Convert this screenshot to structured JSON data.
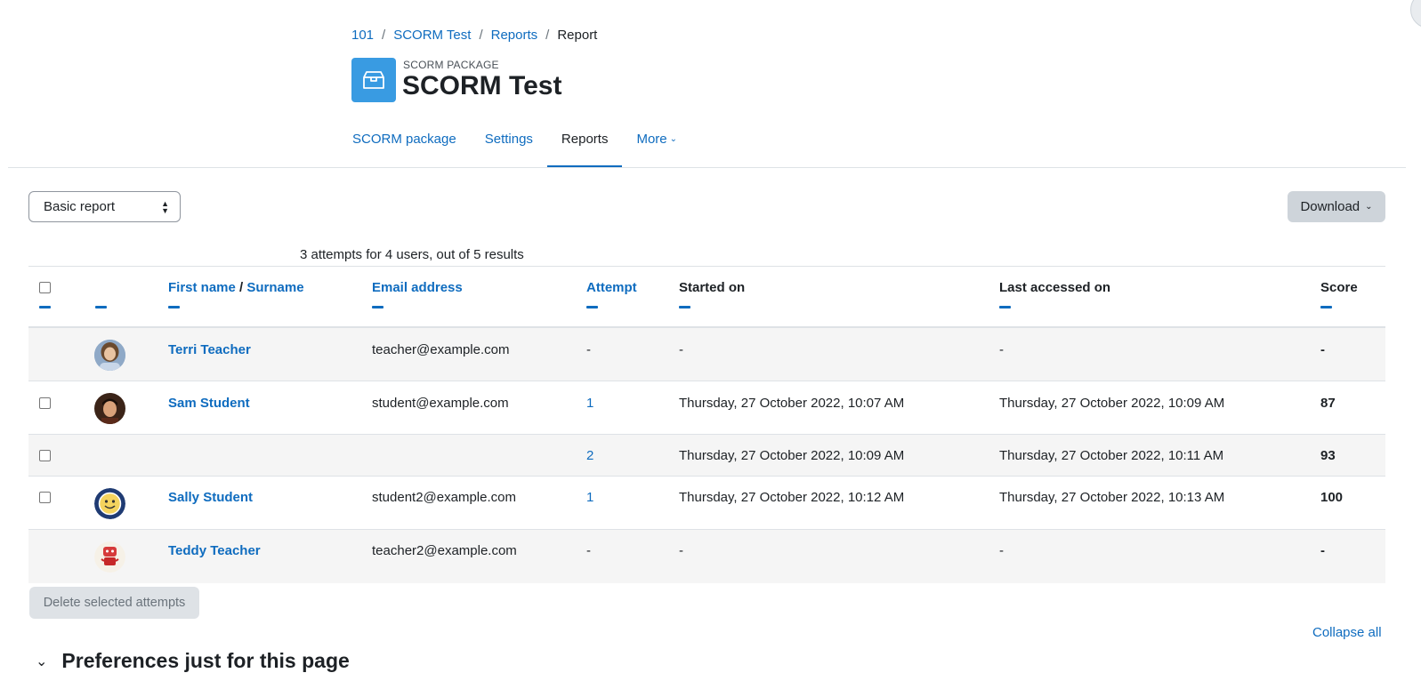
{
  "breadcrumb": [
    "101",
    "SCORM Test",
    "Reports",
    "Report"
  ],
  "header": {
    "module_label": "SCORM PACKAGE",
    "title": "SCORM Test",
    "icon": "package-icon",
    "icon_color": "#399be2"
  },
  "tabs": [
    {
      "label": "SCORM package",
      "active": false
    },
    {
      "label": "Settings",
      "active": false
    },
    {
      "label": "Reports",
      "active": true
    },
    {
      "label": "More",
      "active": false
    }
  ],
  "report_select": {
    "value": "Basic report"
  },
  "download": {
    "label": "Download"
  },
  "summary": "3 attempts for 4 users, out of 5 results",
  "table": {
    "headers": {
      "firstname": "First name",
      "name_separator": "/",
      "surname": "Surname",
      "email": "Email address",
      "attempt": "Attempt",
      "started": "Started on",
      "last_accessed": "Last accessed on",
      "score": "Score"
    },
    "rows": [
      {
        "name": "Terri Teacher",
        "email": "teacher@example.com",
        "attempt": "-",
        "started": "-",
        "last": "-",
        "score": "-",
        "avatar": "teacher-photo"
      },
      {
        "name": "Sam Student",
        "email": "student@example.com",
        "attempt": "1",
        "started": "Thursday, 27 October 2022, 10:07 AM",
        "last": "Thursday, 27 October 2022, 10:09 AM",
        "score": "87",
        "avatar": "student-photo"
      },
      {
        "name": "",
        "email": "",
        "attempt": "2",
        "started": "Thursday, 27 October 2022, 10:09 AM",
        "last": "Thursday, 27 October 2022, 10:11 AM",
        "score": "93",
        "avatar": ""
      },
      {
        "name": "Sally Student",
        "email": "student2@example.com",
        "attempt": "1",
        "started": "Thursday, 27 October 2022, 10:12 AM",
        "last": "Thursday, 27 October 2022, 10:13 AM",
        "score": "100",
        "avatar": "smiley-avatar"
      },
      {
        "name": "Teddy Teacher",
        "email": "teacher2@example.com",
        "attempt": "-",
        "started": "-",
        "last": "-",
        "score": "-",
        "avatar": "robot-avatar"
      }
    ]
  },
  "actions": {
    "delete": "Delete selected attempts",
    "collapse_all": "Collapse all"
  },
  "preferences": {
    "heading": "Preferences just for this page"
  },
  "colors": {
    "link": "#0f6cbf",
    "row_stripe": "#f5f5f5"
  }
}
